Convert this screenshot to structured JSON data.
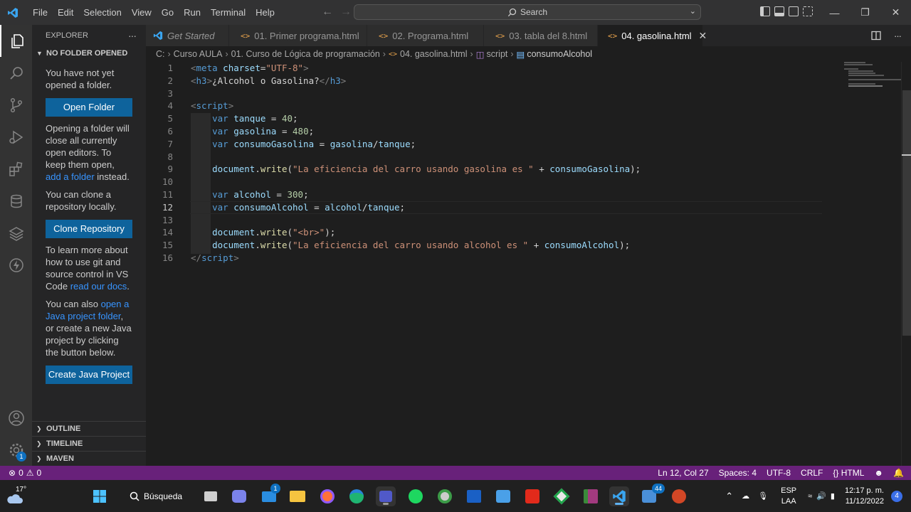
{
  "menu": [
    "File",
    "Edit",
    "Selection",
    "View",
    "Go",
    "Run",
    "Terminal",
    "Help"
  ],
  "search": {
    "label": "Search"
  },
  "sidebar": {
    "title": "EXPLORER",
    "more": "···",
    "section": "NO FOLDER OPENED",
    "p1": "You have not yet opened a folder.",
    "open_folder": "Open Folder",
    "p2_a": "Opening a folder will close all currently open editors. To keep them open, ",
    "p2_link": "add a folder",
    "p2_b": " instead.",
    "p3": "You can clone a repository locally.",
    "clone_repo": "Clone Repository",
    "p4_a": "To learn more about how to use git and source control in VS Code ",
    "p4_link": "read our docs",
    "p4_b": ".",
    "p5_a": "You can also ",
    "p5_link": "open a Java project folder",
    "p5_b": ", or create a new Java project by clicking the button below.",
    "create_java": "Create Java Project",
    "bottom": [
      "OUTLINE",
      "TIMELINE",
      "MAVEN"
    ]
  },
  "tabs": [
    {
      "label": "Get Started",
      "italic": true
    },
    {
      "label": "01. Primer programa.html"
    },
    {
      "label": "02. Programa.html"
    },
    {
      "label": "03. tabla del 8.html"
    },
    {
      "label": "04. gasolina.html",
      "active": true
    }
  ],
  "breadcrumb": [
    "C:",
    "Curso AULA",
    "01. Curso de Lógica de programación",
    "04. gasolina.html",
    "script",
    "consumoAlcohol"
  ],
  "editor": {
    "current_line": 12,
    "line_numbers": [
      "1",
      "2",
      "3",
      "4",
      "5",
      "6",
      "7",
      "8",
      "9",
      "10",
      "11",
      "12",
      "13",
      "14",
      "15",
      "16"
    ],
    "lines": [
      [
        [
          "t-br",
          "<"
        ],
        [
          "t-tag",
          "meta "
        ],
        [
          "t-attr",
          "charset"
        ],
        [
          "t-txt",
          "="
        ],
        [
          "t-str",
          "\"UTF-8\""
        ],
        [
          "t-br",
          ">"
        ]
      ],
      [
        [
          "t-br",
          "<"
        ],
        [
          "t-tag",
          "h3"
        ],
        [
          "t-br",
          ">"
        ],
        [
          "t-txt",
          "¿Alcohol o Gasolina?"
        ],
        [
          "t-br",
          "</"
        ],
        [
          "t-tag",
          "h3"
        ],
        [
          "t-br",
          ">"
        ]
      ],
      [],
      [
        [
          "t-br",
          "<"
        ],
        [
          "t-tag",
          "script"
        ],
        [
          "t-br",
          ">"
        ]
      ],
      [
        [
          "t-txt",
          "    "
        ],
        [
          "t-kw",
          "var "
        ],
        [
          "t-var",
          "tanque"
        ],
        [
          "t-txt",
          " = "
        ],
        [
          "t-num",
          "40"
        ],
        [
          "t-txt",
          ";"
        ]
      ],
      [
        [
          "t-txt",
          "    "
        ],
        [
          "t-kw",
          "var "
        ],
        [
          "t-var",
          "gasolina"
        ],
        [
          "t-txt",
          " = "
        ],
        [
          "t-num",
          "480"
        ],
        [
          "t-txt",
          ";"
        ]
      ],
      [
        [
          "t-txt",
          "    "
        ],
        [
          "t-kw",
          "var "
        ],
        [
          "t-var",
          "consumoGasolina"
        ],
        [
          "t-txt",
          " = "
        ],
        [
          "t-var",
          "gasolina"
        ],
        [
          "t-txt",
          "/"
        ],
        [
          "t-var",
          "tanque"
        ],
        [
          "t-txt",
          ";"
        ]
      ],
      [],
      [
        [
          "t-txt",
          "    "
        ],
        [
          "t-var",
          "document"
        ],
        [
          "t-txt",
          "."
        ],
        [
          "t-fn",
          "write"
        ],
        [
          "t-txt",
          "("
        ],
        [
          "t-str",
          "\"La eficiencia del carro usando gasolina es \""
        ],
        [
          "t-txt",
          " + "
        ],
        [
          "t-var",
          "consumoGasolina"
        ],
        [
          "t-txt",
          ");"
        ]
      ],
      [],
      [
        [
          "t-txt",
          "    "
        ],
        [
          "t-kw",
          "var "
        ],
        [
          "t-var",
          "alcohol"
        ],
        [
          "t-txt",
          " = "
        ],
        [
          "t-num",
          "300"
        ],
        [
          "t-txt",
          ";"
        ]
      ],
      [
        [
          "t-txt",
          "    "
        ],
        [
          "t-kw",
          "var "
        ],
        [
          "t-var",
          "consumoAlcohol"
        ],
        [
          "t-txt",
          " = "
        ],
        [
          "t-var",
          "alcohol"
        ],
        [
          "t-txt",
          "/"
        ],
        [
          "t-var",
          "tanque"
        ],
        [
          "t-txt",
          ";"
        ]
      ],
      [],
      [
        [
          "t-txt",
          "    "
        ],
        [
          "t-var",
          "document"
        ],
        [
          "t-txt",
          "."
        ],
        [
          "t-fn",
          "write"
        ],
        [
          "t-txt",
          "("
        ],
        [
          "t-str",
          "\"<br>\""
        ],
        [
          "t-txt",
          ");"
        ]
      ],
      [
        [
          "t-txt",
          "    "
        ],
        [
          "t-var",
          "document"
        ],
        [
          "t-txt",
          "."
        ],
        [
          "t-fn",
          "write"
        ],
        [
          "t-txt",
          "("
        ],
        [
          "t-str",
          "\"La eficiencia del carro usando alcohol es \""
        ],
        [
          "t-txt",
          " + "
        ],
        [
          "t-var",
          "consumoAlcohol"
        ],
        [
          "t-txt",
          ");"
        ]
      ],
      [
        [
          "t-br",
          "</"
        ],
        [
          "t-tag",
          "script"
        ],
        [
          "t-br",
          ">"
        ]
      ]
    ]
  },
  "status": {
    "errors": "0",
    "warnings": "0",
    "position": "Ln 12, Col 27",
    "spaces": "Spaces: 4",
    "encoding": "UTF-8",
    "eol": "CRLF",
    "language": "HTML"
  },
  "taskbar": {
    "temperature": "17°",
    "search_label": "Búsqueda",
    "mail_badge": "1",
    "teams_badge": "44",
    "lang_top": "ESP",
    "lang_bottom": "LAA",
    "time": "12:17 p. m.",
    "date": "11/12/2022",
    "notifications": "4"
  },
  "colors": {
    "statusbar": "#68217a",
    "accent": "#0e639c",
    "tab_icon": "#e8a34c"
  }
}
